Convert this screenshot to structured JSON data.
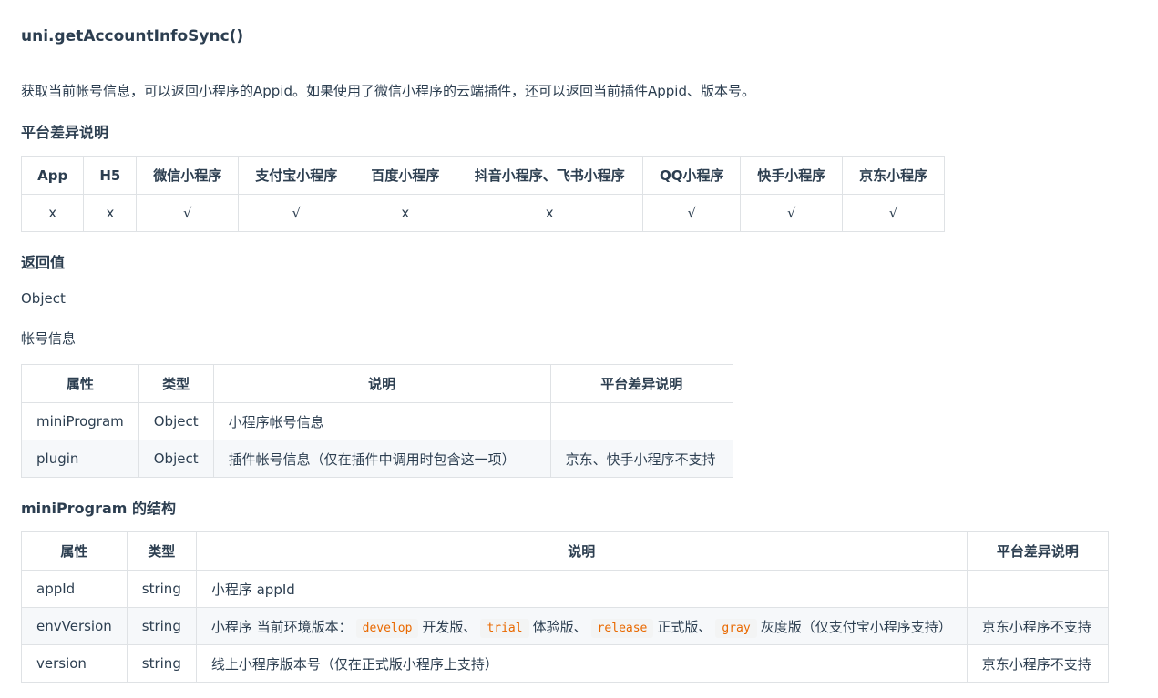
{
  "title": "uni.getAccountInfoSync()",
  "description": "获取当前帐号信息，可以返回小程序的Appid。如果使用了微信小程序的云端插件，还可以返回当前插件Appid、版本号。",
  "platform_heading": "平台差异说明",
  "platform_table": {
    "headers": [
      "App",
      "H5",
      "微信小程序",
      "支付宝小程序",
      "百度小程序",
      "抖音小程序、飞书小程序",
      "QQ小程序",
      "快手小程序",
      "京东小程序"
    ],
    "values": [
      "x",
      "x",
      "√",
      "√",
      "x",
      "x",
      "√",
      "√",
      "√"
    ]
  },
  "return_heading": "返回值",
  "return_type": "Object",
  "return_desc": "帐号信息",
  "account_table": {
    "headers": [
      "属性",
      "类型",
      "说明",
      "平台差异说明"
    ],
    "rows": [
      [
        "miniProgram",
        "Object",
        "小程序帐号信息",
        ""
      ],
      [
        "plugin",
        "Object",
        "插件帐号信息（仅在插件中调用时包含这一项）",
        "京东、快手小程序不支持"
      ]
    ]
  },
  "structure_heading": "miniProgram 的结构",
  "mini_table": {
    "headers": [
      "属性",
      "类型",
      "说明",
      "平台差异说明"
    ],
    "row1": [
      "appId",
      "string",
      "小程序 appId",
      ""
    ],
    "row2": {
      "prop": "envVersion",
      "type": "string",
      "desc_prefix": "小程序 当前环境版本：",
      "code1": "develop",
      "text1": "开发版、",
      "code2": "trial",
      "text2": "体验版、",
      "code3": "release",
      "text3": "正式版、",
      "code4": "gray",
      "text4": "灰度版（仅支付宝小程序支持）",
      "platform": "京东小程序不支持"
    },
    "row3": [
      "version",
      "string",
      "线上小程序版本号（仅在正式版小程序上支持）",
      "京东小程序不支持"
    ]
  }
}
